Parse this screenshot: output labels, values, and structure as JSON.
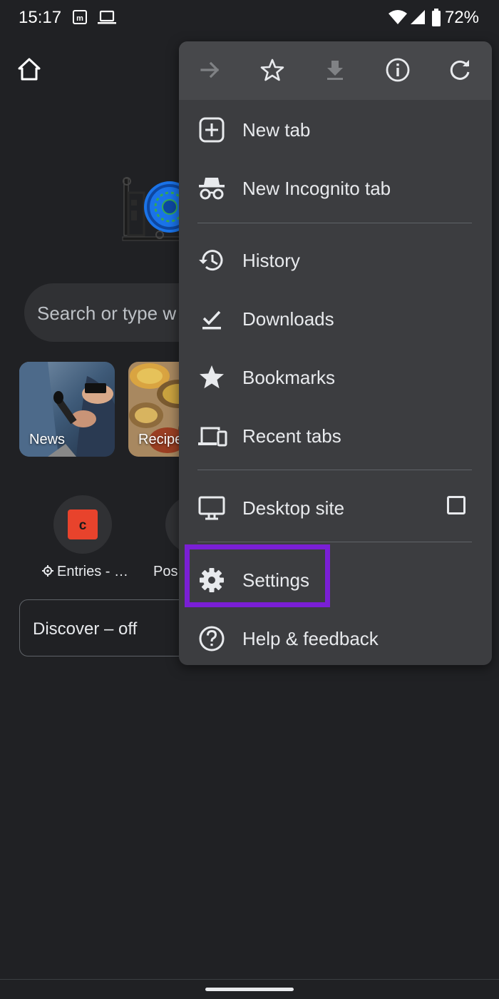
{
  "status_bar": {
    "time": "15:17",
    "battery_percent": "72%",
    "icons": [
      "notification-m-icon",
      "laptop-icon",
      "wifi-icon",
      "signal-icon",
      "battery-icon"
    ]
  },
  "new_tab_page": {
    "search_placeholder": "Search or type w",
    "tiles": [
      {
        "label": "News",
        "icon": "news-thumbnail"
      },
      {
        "label": "Recipe",
        "icon": "recipe-thumbnail"
      }
    ],
    "shortcuts": [
      {
        "label": "Entries - …",
        "icon": "c-site-icon",
        "prefix_icon": "gear-icon"
      },
      {
        "label": "Pos",
        "icon": "site-icon"
      }
    ],
    "discover_label": "Discover – off"
  },
  "menu": {
    "toolbar": [
      "forward-icon",
      "bookmark-star-icon",
      "download-icon",
      "info-icon",
      "reload-icon"
    ],
    "items": [
      {
        "label": "New tab",
        "icon": "new-tab-icon"
      },
      {
        "label": "New Incognito tab",
        "icon": "incognito-icon"
      },
      {
        "label": "History",
        "icon": "history-icon"
      },
      {
        "label": "Downloads",
        "icon": "downloads-icon"
      },
      {
        "label": "Bookmarks",
        "icon": "star-icon"
      },
      {
        "label": "Recent tabs",
        "icon": "devices-icon"
      },
      {
        "label": "Desktop site",
        "icon": "desktop-icon",
        "checked": false
      },
      {
        "label": "Settings",
        "icon": "gear-icon",
        "highlighted": true
      },
      {
        "label": "Help & feedback",
        "icon": "help-icon"
      }
    ]
  },
  "colors": {
    "background": "#202124",
    "menu_background": "#3c3d40",
    "highlight": "#7a1fd6",
    "shortcut_accent": "#e8432c"
  }
}
